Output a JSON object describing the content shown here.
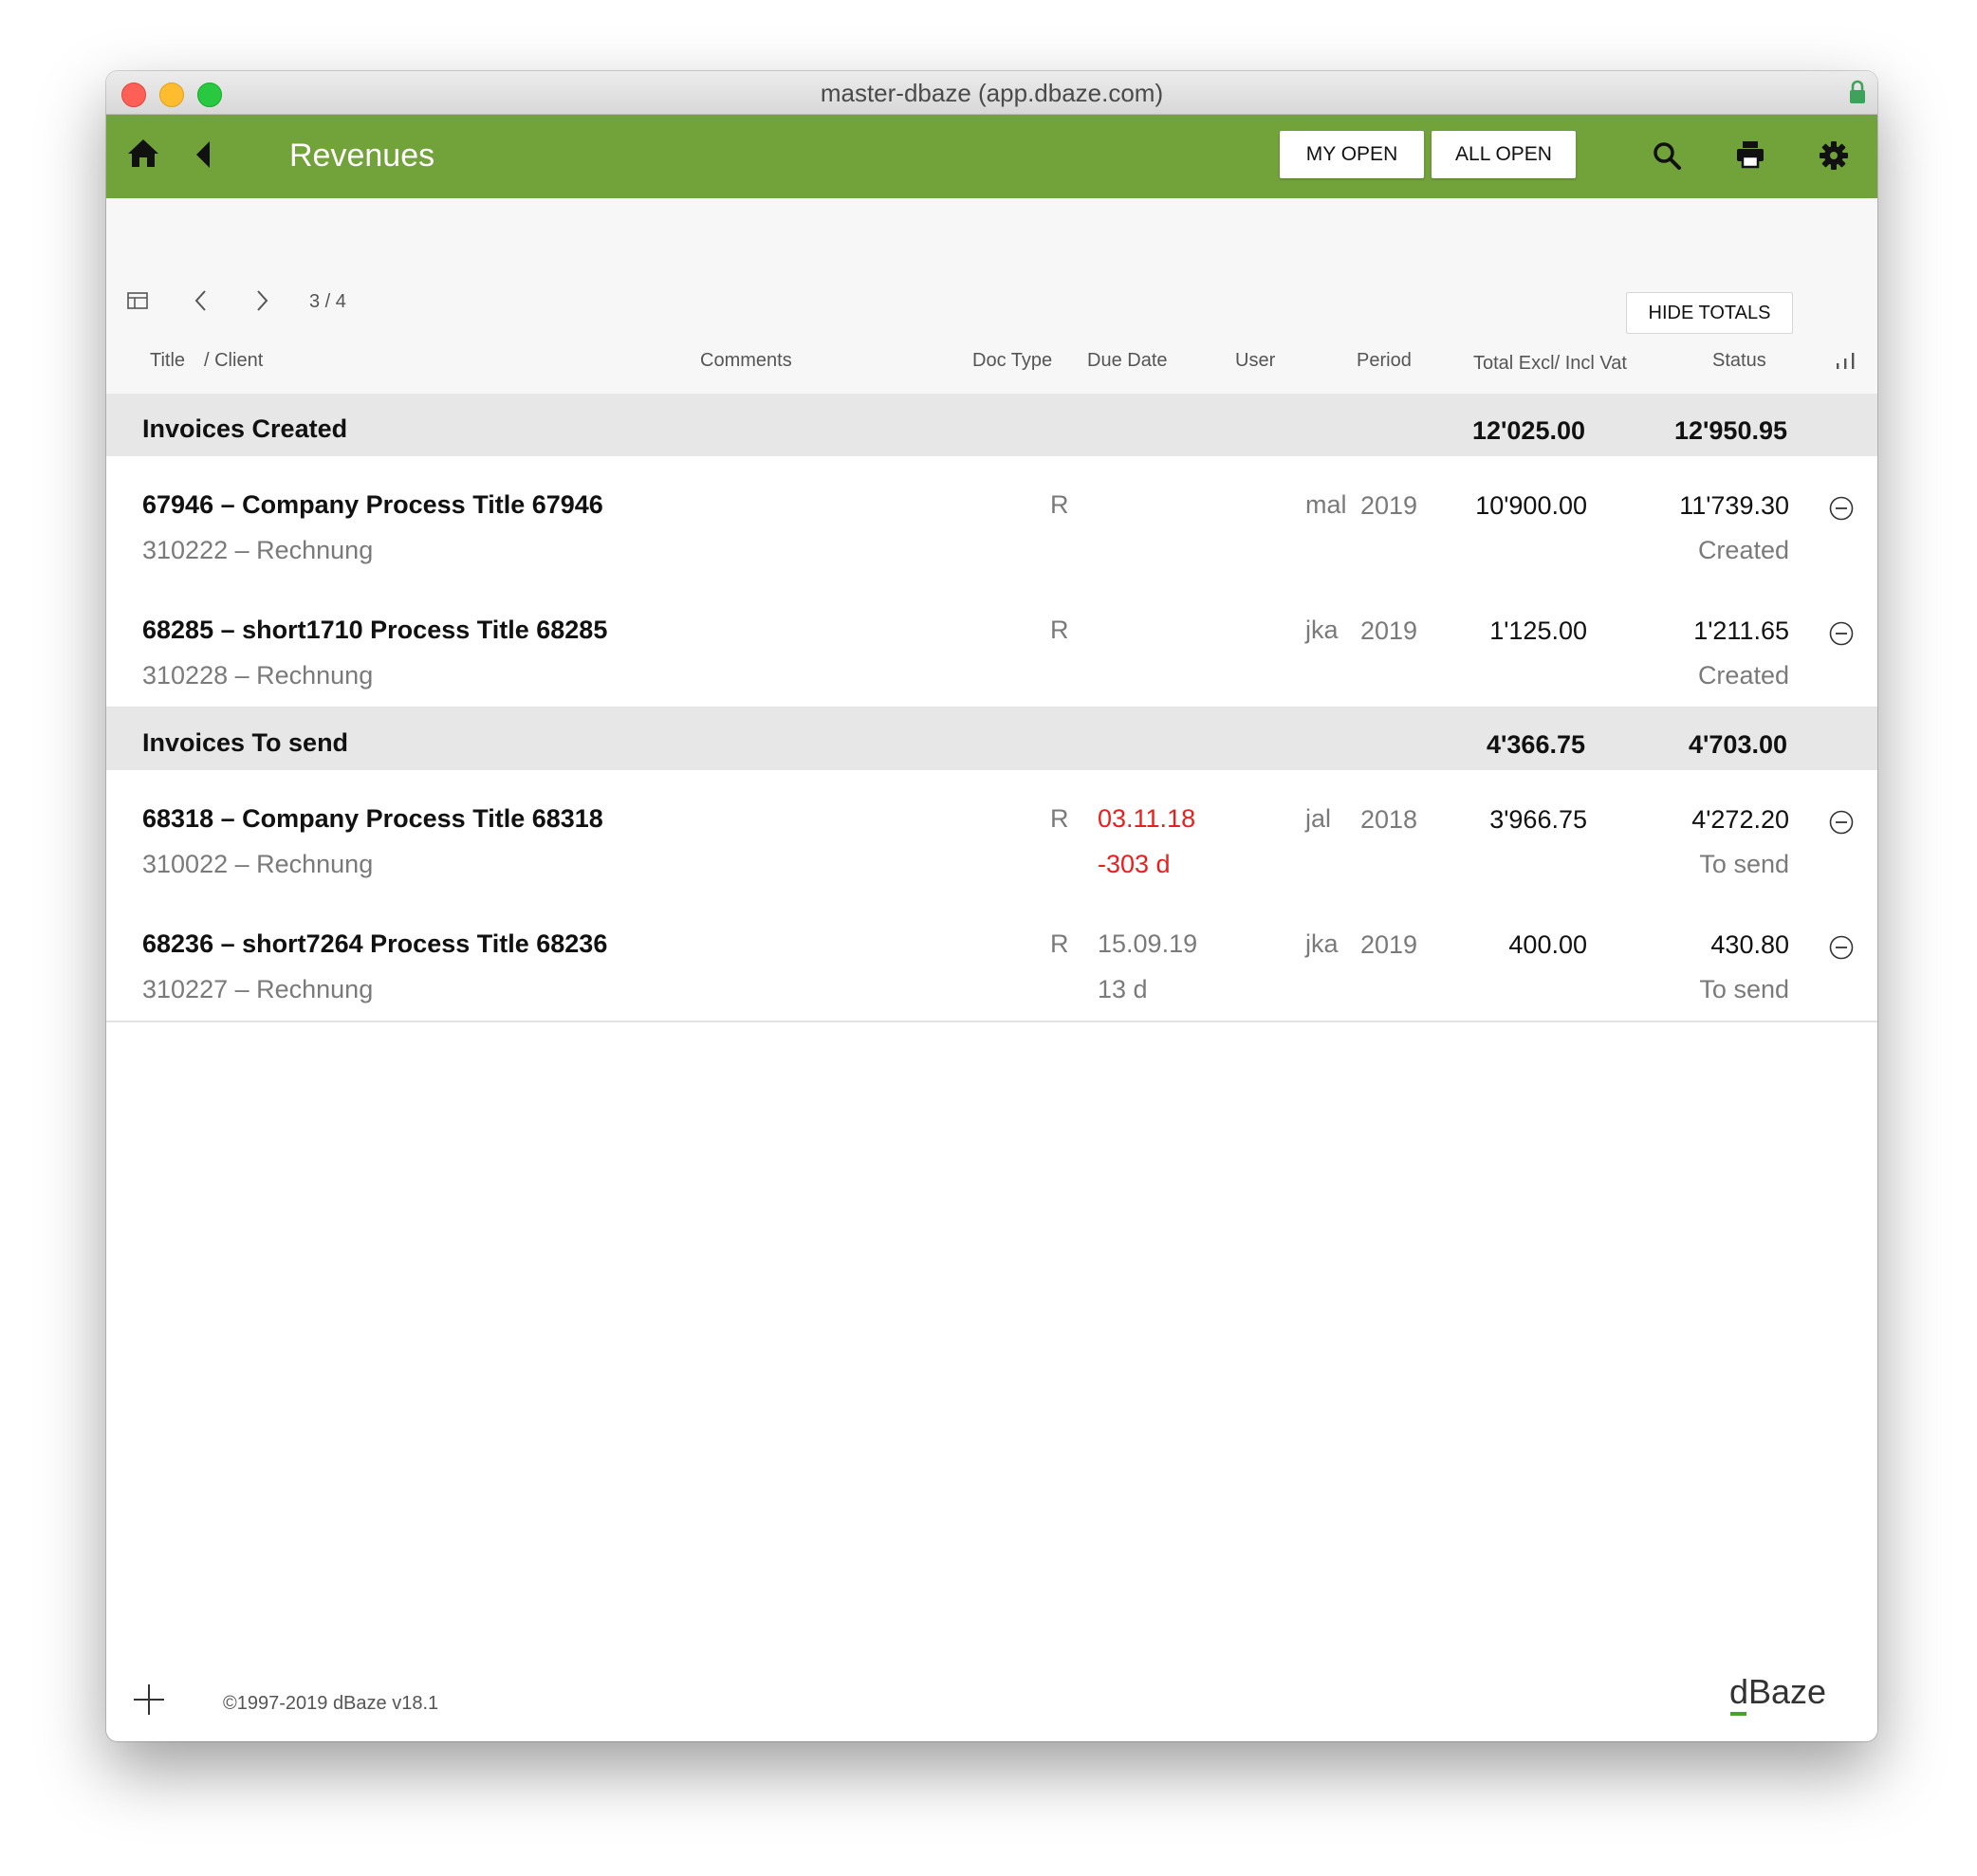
{
  "window": {
    "title": "master-dbaze (app.dbaze.com)"
  },
  "app_bar": {
    "title": "Revenues",
    "filters": {
      "my_open": "MY OPEN",
      "all_open": "ALL OPEN"
    },
    "icons": [
      "home-icon",
      "back-icon",
      "search-icon",
      "print-icon",
      "gear-icon"
    ],
    "color": "#72a23a"
  },
  "toolbar": {
    "page_indicator": "3 / 4",
    "hide_totals_label": "HIDE TOTALS",
    "icons": [
      "column-layout-icon",
      "chevron-left-icon",
      "chevron-right-icon"
    ]
  },
  "columns": {
    "title": "Title",
    "client": "/ Client",
    "comments": "Comments",
    "doc_type": "Doc Type",
    "due_date": "Due Date",
    "user": "User",
    "period": "Period",
    "total": "Total Excl/ Incl Vat",
    "status": "Status"
  },
  "groups": [
    {
      "title": "Invoices Created",
      "total_excl": "12'025.00",
      "total_incl": "12'950.95",
      "rows": [
        {
          "title": "67946 – Company Process Title 67946",
          "client": "310222 – Rechnung",
          "doc_type": "R",
          "due_date": "",
          "due_days": "",
          "overdue": false,
          "user": "mal",
          "period": "2019",
          "total_excl": "10'900.00",
          "total_incl": "11'739.30",
          "status": "Created"
        },
        {
          "title": "68285 – short1710 Process Title 68285",
          "client": "310228 – Rechnung",
          "doc_type": "R",
          "due_date": "",
          "due_days": "",
          "overdue": false,
          "user": "jka",
          "period": "2019",
          "total_excl": "1'125.00",
          "total_incl": "1'211.65",
          "status": "Created"
        }
      ]
    },
    {
      "title": "Invoices To send",
      "total_excl": "4'366.75",
      "total_incl": "4'703.00",
      "rows": [
        {
          "title": "68318 – Company Process Title 68318",
          "client": "310022 – Rechnung",
          "doc_type": "R",
          "due_date": "03.11.18",
          "due_days": "-303 d",
          "overdue": true,
          "user": "jal",
          "period": "2018",
          "total_excl": "3'966.75",
          "total_incl": "4'272.20",
          "status": "To send"
        },
        {
          "title": "68236 – short7264 Process Title 68236",
          "client": "310227 – Rechnung",
          "doc_type": "R",
          "due_date": "15.09.19",
          "due_days": "13 d",
          "overdue": false,
          "user": "jka",
          "period": "2019",
          "total_excl": "400.00",
          "total_incl": "430.80",
          "status": "To send"
        }
      ]
    }
  ],
  "footer": {
    "copyright": "©1997-2019 dBaze v18.1",
    "brand": "dBaze"
  },
  "colors": {
    "overdue": "#e8201c",
    "brand_accent": "#4aa02c"
  }
}
